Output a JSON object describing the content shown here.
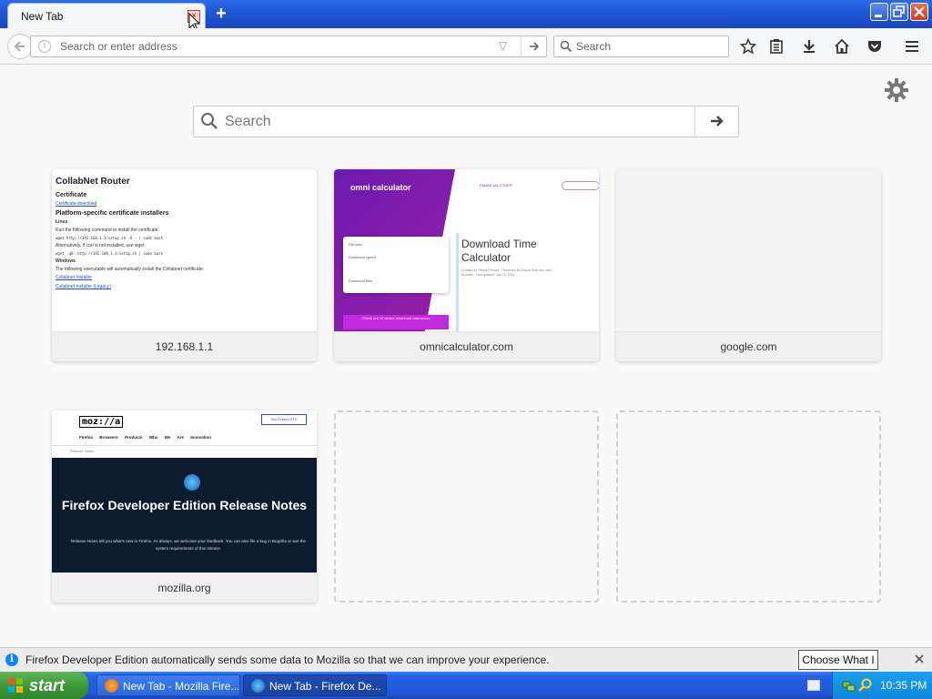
{
  "tab": {
    "title": "New Tab",
    "close_symbol": "×"
  },
  "toolbar": {
    "url_placeholder": "Search or enter address",
    "search_placeholder": "Search"
  },
  "newtab": {
    "search_placeholder": "Search"
  },
  "tiles": [
    {
      "caption": "192.168.1.1",
      "thumb": {
        "title": "CollabNet Router",
        "certificate_heading": "Certificate",
        "certificate_link": "Certificate download",
        "installers_heading": "Platform-specific certificate installers",
        "linux_heading": "Linux",
        "linux_text": "Run the following command to install the certificate:",
        "linux_cmd": "wget http://192.168.1.1/setup.sh -O - | sudo bash -",
        "alt_text": "Alternatively, if curl is not installed, use wget:",
        "alt_cmd": "wget -qO- http://192.168.1.1/setup.sh | sudo bash -",
        "windows_heading": "Windows",
        "windows_text": "The following executable will automatically install the Collabnet certificate:",
        "installer_link": "Collabnet Installer",
        "installer_legacy_link": "Collabnet Installer (Legacy)"
      }
    },
    {
      "caption": "omnicalculator.com",
      "thumb": {
        "logo": "omni calculator",
        "nav": "FINANCIAL  OTHER",
        "page_title": "Download Time Calculator",
        "meta": "Created by Hanna Pamula · Reviewed by Bogna Szyk and Jack Bowater · Last updated: Jan 18, 2024",
        "field1": "File size",
        "field2": "Download speed",
        "field3": "Download time",
        "ad": "Check out 12 similar download calculators"
      }
    },
    {
      "caption": "google.com"
    },
    {
      "caption": "mozilla.org",
      "thumb": {
        "logo": "moz://a",
        "download_button": "Get Firefox DTC",
        "menu": "Firefox Browsers  Products  Who We Are  Innovation",
        "subnav": "Release Notes",
        "hero_title": "Firefox Developer Edition Release Notes",
        "hero_body": "Release Notes tell you what's new in Firefox. As always, we welcome your feedback. You can also file a bug in Bugzilla or see the system requirements of this release."
      }
    }
  ],
  "notification": {
    "message": "Firefox Developer Edition automatically sends some data to Mozilla so that we can improve your experience.",
    "button": "Choose What I Share"
  },
  "taskbar": {
    "start": "start",
    "tasks": [
      {
        "label": "New Tab - Mozilla Fire..."
      },
      {
        "label": "New Tab - Firefox De..."
      }
    ],
    "clock": "10:35 PM"
  },
  "colors": {
    "xp_blue": "#2157d8",
    "start_green": "#3b9a36",
    "accent_purple": "#6c1ab0",
    "info_blue": "#0a84ff"
  },
  "icons": {
    "back": "arrow-left-icon",
    "identity": "info-icon",
    "go": "arrow-right-icon",
    "search": "magnifier-icon",
    "bookmark_star": "star-icon",
    "bookmarks_menu": "bookmarks-icon",
    "downloads": "download-icon",
    "home": "home-icon",
    "pocket": "pocket-icon",
    "menu": "hamburger-icon",
    "settings": "gear-icon"
  }
}
